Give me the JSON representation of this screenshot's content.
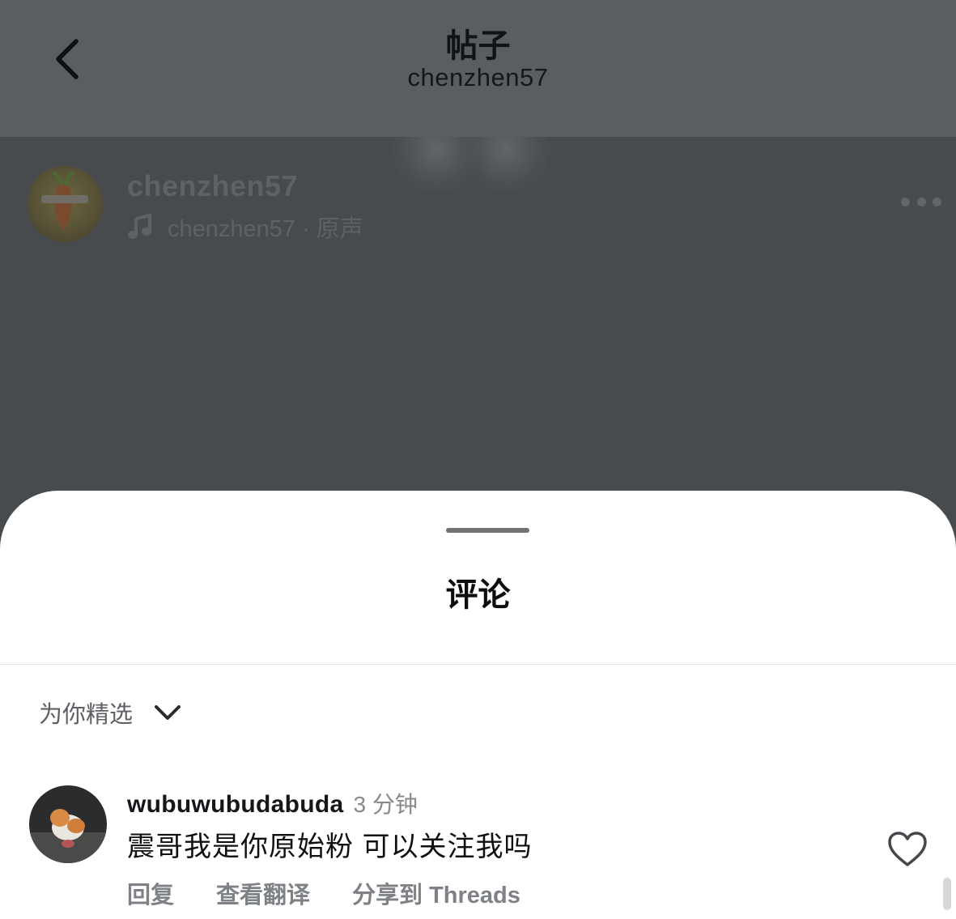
{
  "header": {
    "title": "帖子",
    "subtitle": "chenzhen57",
    "back_icon": "chevron-left-icon"
  },
  "post": {
    "username": "chenzhen57",
    "audio_label": "chenzhen57 · 原声",
    "audio_icon": "music-note-icon",
    "more_icon": "more-horizontal-icon"
  },
  "comments_sheet": {
    "title": "评论",
    "filter_label": "为你精选",
    "filter_icon": "chevron-down-icon",
    "comments": [
      {
        "username": "wubuwubudabuda",
        "time": "3 分钟",
        "text": "震哥我是你原始粉 可以关注我吗",
        "actions": {
          "reply": "回复",
          "translate": "查看翻译",
          "share": "分享到 Threads"
        },
        "like_icon": "heart-outline-icon"
      }
    ]
  },
  "colors": {
    "header_bg": "#5b5e61",
    "post_overlay": "#484b4e",
    "sheet_bg": "#ffffff",
    "secondary_text": "#7e8185"
  }
}
